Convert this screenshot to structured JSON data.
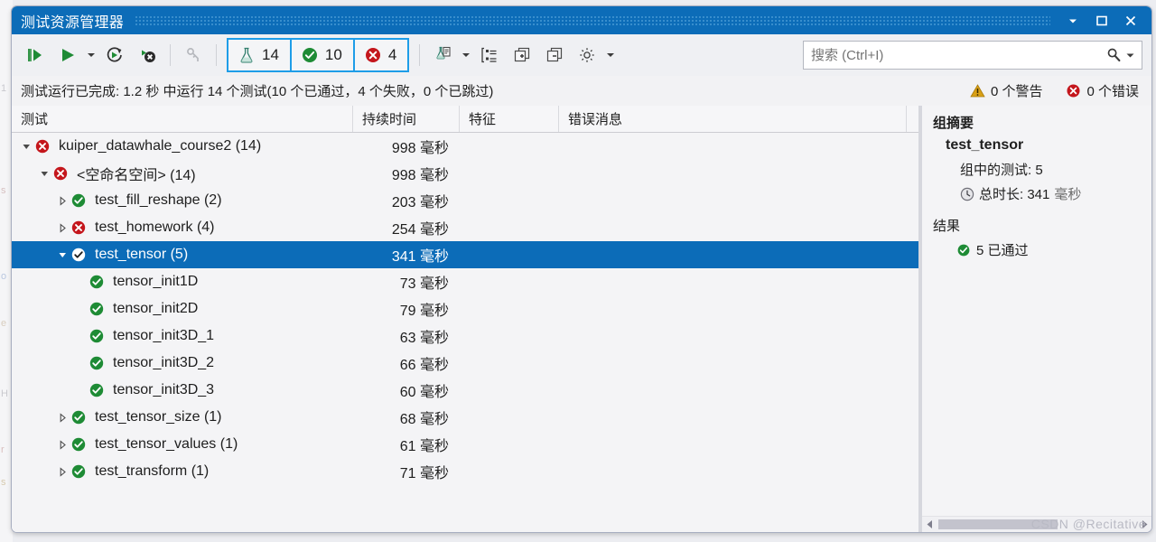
{
  "window": {
    "title": "测试资源管理器",
    "controls": [
      {
        "name": "dropdown",
        "glyph": "▼"
      },
      {
        "name": "maximize",
        "glyph": "❐"
      },
      {
        "name": "close",
        "glyph": "✕"
      }
    ]
  },
  "toolbar": {
    "run_all_label": "运行所有测试",
    "run_label": "运行",
    "run_dropdown_label": "运行下拉",
    "repeat_label": "重复上次运行",
    "cancel_label": "取消",
    "filter_label": "筛选",
    "counters": [
      {
        "name": "total",
        "icon": "flask-icon",
        "value": "14"
      },
      {
        "name": "passed",
        "icon": "check-circle-icon",
        "value": "10"
      },
      {
        "name": "failed",
        "icon": "error-circle-icon",
        "value": "4"
      }
    ],
    "playlist_label": "播放列表",
    "playlist_dropdown_label": "播放列表下拉",
    "grouping_label": "分组方式",
    "expand_label": "全部展开",
    "collapse_label": "全部折叠",
    "settings_label": "设置",
    "settings_dropdown_label": "设置下拉"
  },
  "search": {
    "value": "",
    "placeholder": "搜索 (Ctrl+I)"
  },
  "status": {
    "message": "测试运行已完成: 1.2 秒 中运行 14 个测试(10 个已通过，4 个失败，0 个已跳过)",
    "warnings": "0 个警告",
    "errors": "0 个错误"
  },
  "grid": {
    "columns": [
      "测试",
      "持续时间",
      "特征",
      "错误消息",
      ""
    ],
    "rows": [
      {
        "indent": 0,
        "twisty": "expanded",
        "status": "failed",
        "label": "kuiper_datawhale_course2 (14)",
        "duration": "998 毫秒",
        "selected": false
      },
      {
        "indent": 1,
        "twisty": "expanded",
        "status": "failed",
        "label": "<空命名空间> (14)",
        "duration": "998 毫秒",
        "selected": false
      },
      {
        "indent": 2,
        "twisty": "collapsed",
        "status": "passed",
        "label": "test_fill_reshape (2)",
        "duration": "203 毫秒",
        "selected": false
      },
      {
        "indent": 2,
        "twisty": "collapsed",
        "status": "failed",
        "label": "test_homework (4)",
        "duration": "254 毫秒",
        "selected": false
      },
      {
        "indent": 2,
        "twisty": "expanded",
        "status": "passed",
        "label": "test_tensor (5)",
        "duration": "341 毫秒",
        "selected": true
      },
      {
        "indent": 3,
        "twisty": "none",
        "status": "passed",
        "label": "tensor_init1D",
        "duration": "73 毫秒",
        "selected": false
      },
      {
        "indent": 3,
        "twisty": "none",
        "status": "passed",
        "label": "tensor_init2D",
        "duration": "79 毫秒",
        "selected": false
      },
      {
        "indent": 3,
        "twisty": "none",
        "status": "passed",
        "label": "tensor_init3D_1",
        "duration": "63 毫秒",
        "selected": false
      },
      {
        "indent": 3,
        "twisty": "none",
        "status": "passed",
        "label": "tensor_init3D_2",
        "duration": "66 毫秒",
        "selected": false
      },
      {
        "indent": 3,
        "twisty": "none",
        "status": "passed",
        "label": "tensor_init3D_3",
        "duration": "60 毫秒",
        "selected": false
      },
      {
        "indent": 2,
        "twisty": "collapsed",
        "status": "passed",
        "label": "test_tensor_size (1)",
        "duration": "68 毫秒",
        "selected": false
      },
      {
        "indent": 2,
        "twisty": "collapsed",
        "status": "passed",
        "label": "test_tensor_values (1)",
        "duration": "61 毫秒",
        "selected": false
      },
      {
        "indent": 2,
        "twisty": "collapsed",
        "status": "passed",
        "label": "test_transform (1)",
        "duration": "71 毫秒",
        "selected": false
      }
    ]
  },
  "summary": {
    "heading": "组摘要",
    "group_name": "test_tensor",
    "tests_in_group": "组中的测试: 5",
    "total_duration_label": "总时长: 341",
    "total_duration_unit": "毫秒",
    "results_heading": "结果",
    "passed_result": "5 已通过"
  },
  "watermark": "CSDN @Recitative",
  "colors": {
    "accent": "#0c6cb8",
    "pass": "#1e8b35",
    "fail": "#c4161c",
    "warn": "#d9a016",
    "counter_border": "#1e9de8"
  }
}
